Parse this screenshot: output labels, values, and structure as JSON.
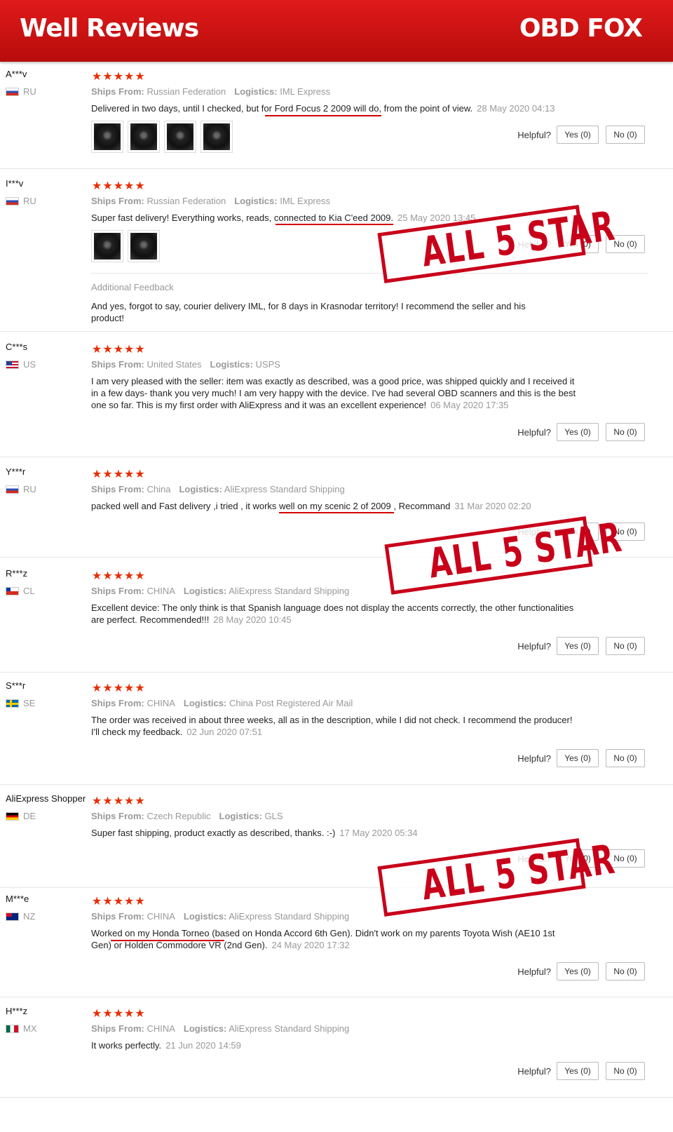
{
  "banner": {
    "title": "Well Reviews",
    "brand": "OBD FOX"
  },
  "labels": {
    "ships_from": "Ships From:",
    "logistics": "Logistics:",
    "helpful": "Helpful?",
    "yes": "Yes (0)",
    "no": "No (0)",
    "stars": "★★★★★",
    "additional_feedback": "Additional Feedback"
  },
  "stamp_text": "ALL 5 STAR",
  "reviews": [
    {
      "user": "A***v",
      "country": "RU",
      "ships_from": "Russian Federation",
      "logistics": "IML Express",
      "text_before": "Delivered in two days, until I checked, but ",
      "text_mark": "for Ford Focus 2 2009 will do",
      "text_after": ", from the point of view.",
      "date": "28 May 2020 04:13"
    },
    {
      "user": "I***v",
      "country": "RU",
      "ships_from": "Russian Federation",
      "logistics": "IML Express",
      "text_before": "Super fast delivery! Everything works, reads, ",
      "text_mark": "connected to Kia C'eed 2009.",
      "text_after": "",
      "date": "25 May 2020 13:45",
      "additional": "And yes, forgot to say, courier delivery IML, for 8 days in Krasnodar territory! I recommend the seller and his product!"
    },
    {
      "user": "C***s",
      "country": "US",
      "ships_from": "United States",
      "logistics": "USPS",
      "text": "I am very pleased with the seller: item was exactly as described, was a good price, was shipped quickly and I received it in a few days- thank you very much! I am very happy with the device. I've had several OBD scanners and this is the best one so far. This is my first order with AliExpress and it was an excellent experience!",
      "date": "06 May 2020 17:35"
    },
    {
      "user": "Y***r",
      "country": "RU",
      "ships_from": "China",
      "logistics": "AliExpress Standard Shipping",
      "text_before": "packed well and Fast delivery ,i tried , it works ",
      "text_mark": "well on my scenic 2 of 2009",
      "text_after": " , Recommand",
      "date": "31 Mar 2020 02:20"
    },
    {
      "user": "R***z",
      "country": "CL",
      "ships_from": "CHINA",
      "logistics": "AliExpress Standard Shipping",
      "text": "Excellent device: The only think is that Spanish language does not display the accents correctly, the other functionalities are perfect. Recommended!!!",
      "date": "28 May 2020 10:45"
    },
    {
      "user": "S***r",
      "country": "SE",
      "ships_from": "CHINA",
      "logistics": "China Post Registered Air Mail",
      "text": "The order was received in about three weeks, all as in the description, while I did not check. I recommend the producer! I'll check my feedback.",
      "date": "02 Jun 2020 07:51"
    },
    {
      "user": "AliExpress Shopper",
      "country": "DE",
      "ships_from": "Czech Republic",
      "logistics": "GLS",
      "text": "Super fast shipping, product exactly as described, thanks. :-)",
      "date": "17 May 2020 05:34"
    },
    {
      "user": "M***e",
      "country": "NZ",
      "ships_from": "CHINA",
      "logistics": "AliExpress Standard Shipping",
      "text_before": "Work",
      "text_mark": "ed on my Honda Torneo (",
      "text_after": "based on Honda Accord 6th Gen). Didn't work on my parents Toyota Wish (AE10 1st Gen) or Holden Commodore VR (2nd Gen).",
      "date": "24 May 2020 17:32"
    },
    {
      "user": "H***z",
      "country": "MX",
      "ships_from": "CHINA",
      "logistics": "AliExpress Standard Shipping",
      "text": "It works perfectly.",
      "date": "21 Jun 2020 14:59"
    }
  ]
}
